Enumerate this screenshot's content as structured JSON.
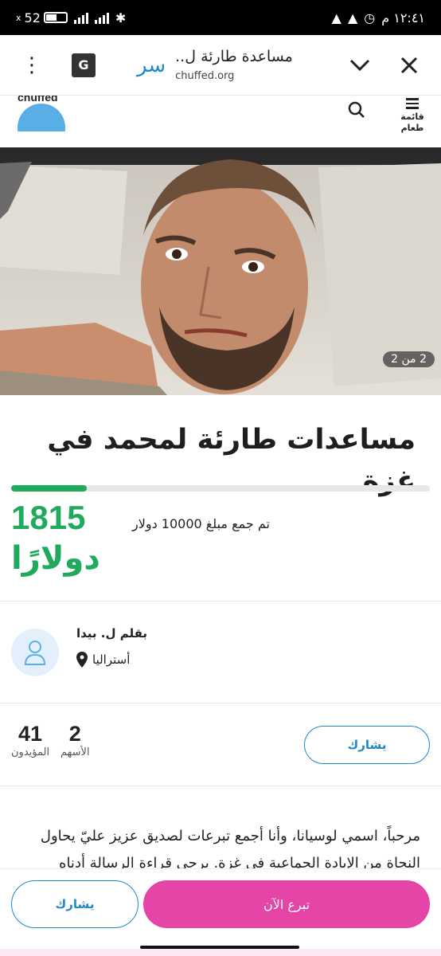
{
  "status_bar": {
    "battery": "52",
    "time": "١٢:٤١ م"
  },
  "browser": {
    "logo": "سر",
    "title": "مساعدة طارئة ل..",
    "url": "chuffed.org",
    "translate_label": "G"
  },
  "site": {
    "brand": "chuffed",
    "menu_label": "قائمة طعام"
  },
  "hero": {
    "counter": "2 من 2"
  },
  "campaign": {
    "title": "مساعدات طارئة لمحمد في غزة",
    "raised_amount": "1815",
    "raised_currency": "دولارًا",
    "goal_text": "تم جمع مبلغ 10000 دولار",
    "progress_fraction": 0.1815
  },
  "organizer": {
    "name": "بقلم ل. بيدا",
    "location": "أستراليا"
  },
  "stats": {
    "supporters_count": "41",
    "supporters_label": "المؤيدون",
    "shares_count": "2",
    "shares_label": "الأسهم",
    "share_label": "يشارك"
  },
  "story": {
    "text": "مرحباً، اسمي لوسيانا، وأنا أجمع تبرعات لصديق عزيز عليّ يحاول النجاة من الإبادة الجماعية في غزة. يرجى قراءة الرسالة أدناه"
  },
  "bottom": {
    "share_label": "يشارك",
    "donate_label": "تبرع الآن"
  },
  "colors": {
    "accent_green": "#1faa5e",
    "accent_blue": "#1e88c8",
    "donate_pink": "#e545a6"
  }
}
